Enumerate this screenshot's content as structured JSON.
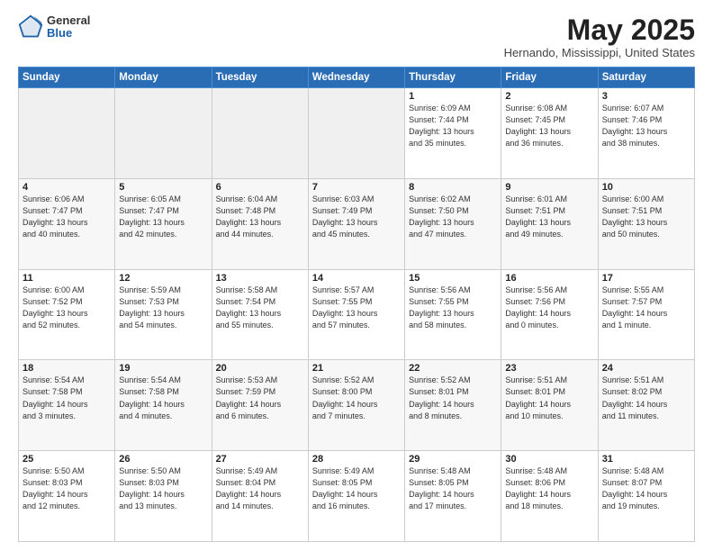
{
  "header": {
    "logo_general": "General",
    "logo_blue": "Blue",
    "month_year": "May 2025",
    "location": "Hernando, Mississippi, United States"
  },
  "days_of_week": [
    "Sunday",
    "Monday",
    "Tuesday",
    "Wednesday",
    "Thursday",
    "Friday",
    "Saturday"
  ],
  "weeks": [
    [
      {
        "num": "",
        "info": ""
      },
      {
        "num": "",
        "info": ""
      },
      {
        "num": "",
        "info": ""
      },
      {
        "num": "",
        "info": ""
      },
      {
        "num": "1",
        "info": "Sunrise: 6:09 AM\nSunset: 7:44 PM\nDaylight: 13 hours\nand 35 minutes."
      },
      {
        "num": "2",
        "info": "Sunrise: 6:08 AM\nSunset: 7:45 PM\nDaylight: 13 hours\nand 36 minutes."
      },
      {
        "num": "3",
        "info": "Sunrise: 6:07 AM\nSunset: 7:46 PM\nDaylight: 13 hours\nand 38 minutes."
      }
    ],
    [
      {
        "num": "4",
        "info": "Sunrise: 6:06 AM\nSunset: 7:47 PM\nDaylight: 13 hours\nand 40 minutes."
      },
      {
        "num": "5",
        "info": "Sunrise: 6:05 AM\nSunset: 7:47 PM\nDaylight: 13 hours\nand 42 minutes."
      },
      {
        "num": "6",
        "info": "Sunrise: 6:04 AM\nSunset: 7:48 PM\nDaylight: 13 hours\nand 44 minutes."
      },
      {
        "num": "7",
        "info": "Sunrise: 6:03 AM\nSunset: 7:49 PM\nDaylight: 13 hours\nand 45 minutes."
      },
      {
        "num": "8",
        "info": "Sunrise: 6:02 AM\nSunset: 7:50 PM\nDaylight: 13 hours\nand 47 minutes."
      },
      {
        "num": "9",
        "info": "Sunrise: 6:01 AM\nSunset: 7:51 PM\nDaylight: 13 hours\nand 49 minutes."
      },
      {
        "num": "10",
        "info": "Sunrise: 6:00 AM\nSunset: 7:51 PM\nDaylight: 13 hours\nand 50 minutes."
      }
    ],
    [
      {
        "num": "11",
        "info": "Sunrise: 6:00 AM\nSunset: 7:52 PM\nDaylight: 13 hours\nand 52 minutes."
      },
      {
        "num": "12",
        "info": "Sunrise: 5:59 AM\nSunset: 7:53 PM\nDaylight: 13 hours\nand 54 minutes."
      },
      {
        "num": "13",
        "info": "Sunrise: 5:58 AM\nSunset: 7:54 PM\nDaylight: 13 hours\nand 55 minutes."
      },
      {
        "num": "14",
        "info": "Sunrise: 5:57 AM\nSunset: 7:55 PM\nDaylight: 13 hours\nand 57 minutes."
      },
      {
        "num": "15",
        "info": "Sunrise: 5:56 AM\nSunset: 7:55 PM\nDaylight: 13 hours\nand 58 minutes."
      },
      {
        "num": "16",
        "info": "Sunrise: 5:56 AM\nSunset: 7:56 PM\nDaylight: 14 hours\nand 0 minutes."
      },
      {
        "num": "17",
        "info": "Sunrise: 5:55 AM\nSunset: 7:57 PM\nDaylight: 14 hours\nand 1 minute."
      }
    ],
    [
      {
        "num": "18",
        "info": "Sunrise: 5:54 AM\nSunset: 7:58 PM\nDaylight: 14 hours\nand 3 minutes."
      },
      {
        "num": "19",
        "info": "Sunrise: 5:54 AM\nSunset: 7:58 PM\nDaylight: 14 hours\nand 4 minutes."
      },
      {
        "num": "20",
        "info": "Sunrise: 5:53 AM\nSunset: 7:59 PM\nDaylight: 14 hours\nand 6 minutes."
      },
      {
        "num": "21",
        "info": "Sunrise: 5:52 AM\nSunset: 8:00 PM\nDaylight: 14 hours\nand 7 minutes."
      },
      {
        "num": "22",
        "info": "Sunrise: 5:52 AM\nSunset: 8:01 PM\nDaylight: 14 hours\nand 8 minutes."
      },
      {
        "num": "23",
        "info": "Sunrise: 5:51 AM\nSunset: 8:01 PM\nDaylight: 14 hours\nand 10 minutes."
      },
      {
        "num": "24",
        "info": "Sunrise: 5:51 AM\nSunset: 8:02 PM\nDaylight: 14 hours\nand 11 minutes."
      }
    ],
    [
      {
        "num": "25",
        "info": "Sunrise: 5:50 AM\nSunset: 8:03 PM\nDaylight: 14 hours\nand 12 minutes."
      },
      {
        "num": "26",
        "info": "Sunrise: 5:50 AM\nSunset: 8:03 PM\nDaylight: 14 hours\nand 13 minutes."
      },
      {
        "num": "27",
        "info": "Sunrise: 5:49 AM\nSunset: 8:04 PM\nDaylight: 14 hours\nand 14 minutes."
      },
      {
        "num": "28",
        "info": "Sunrise: 5:49 AM\nSunset: 8:05 PM\nDaylight: 14 hours\nand 16 minutes."
      },
      {
        "num": "29",
        "info": "Sunrise: 5:48 AM\nSunset: 8:05 PM\nDaylight: 14 hours\nand 17 minutes."
      },
      {
        "num": "30",
        "info": "Sunrise: 5:48 AM\nSunset: 8:06 PM\nDaylight: 14 hours\nand 18 minutes."
      },
      {
        "num": "31",
        "info": "Sunrise: 5:48 AM\nSunset: 8:07 PM\nDaylight: 14 hours\nand 19 minutes."
      }
    ]
  ]
}
